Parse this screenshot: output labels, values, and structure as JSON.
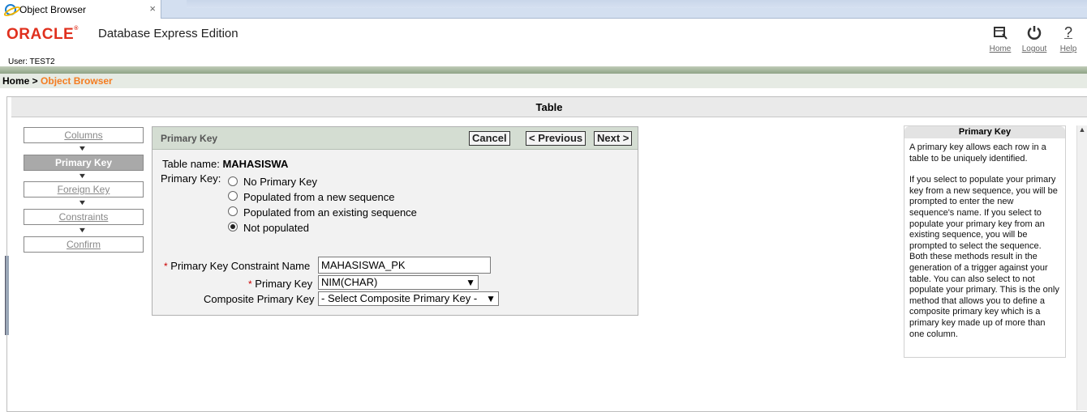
{
  "browser": {
    "tab_title": "Object Browser",
    "close_glyph": "×"
  },
  "header": {
    "brand": "ORACLE",
    "product": "Database Express Edition",
    "user_label": "User: TEST2",
    "links": [
      {
        "label": "Home",
        "icon": "home-icon"
      },
      {
        "label": "Logout",
        "icon": "power-icon"
      },
      {
        "label": "Help",
        "icon": "help-icon"
      }
    ]
  },
  "breadcrumb": {
    "home": "Home",
    "sep": " > ",
    "current": "Object Browser"
  },
  "page": {
    "title": "Table"
  },
  "steps": [
    {
      "label": "Columns",
      "active": false
    },
    {
      "label": "Primary Key",
      "active": true
    },
    {
      "label": "Foreign Key",
      "active": false
    },
    {
      "label": "Constraints",
      "active": false
    },
    {
      "label": "Confirm",
      "active": false
    }
  ],
  "panel": {
    "title": "Primary Key",
    "buttons": {
      "cancel": "Cancel",
      "previous": "< Previous",
      "next": "Next >"
    },
    "table_name_label": "Table name: ",
    "table_name_value": "MAHASISWA",
    "pk_label": "Primary Key:",
    "options": [
      {
        "label": "No Primary Key",
        "selected": false
      },
      {
        "label": "Populated from a new sequence",
        "selected": false
      },
      {
        "label": "Populated from an existing sequence",
        "selected": false
      },
      {
        "label": "Not populated",
        "selected": true
      }
    ],
    "required_mark": "*",
    "constraint_name_label": "Primary Key Constraint Name",
    "constraint_name_value": "MAHASISWA_PK",
    "primary_key_label": "Primary Key",
    "primary_key_value": "NIM(CHAR)",
    "composite_label": "Composite Primary Key",
    "composite_value": "- Select Composite Primary Key -"
  },
  "help": {
    "title": "Primary Key",
    "paragraphs": [
      "A primary key allows each row in a table to be uniquely identified.",
      "If you select to populate your primary key from a new sequence, you will be prompted to enter the new sequence's name. If you select to populate your primary key from an existing sequence, you will be prompted to select the sequence. Both these methods result in the generation of a trigger against your table. You can also select to not populate your primary. This is the only method that allows you to define a composite primary key which is a primary key made up of more than one column."
    ]
  },
  "colors": {
    "brand_red": "#e0301e",
    "accent_orange": "#f47c20",
    "panel_head": "#d4ddd2"
  }
}
